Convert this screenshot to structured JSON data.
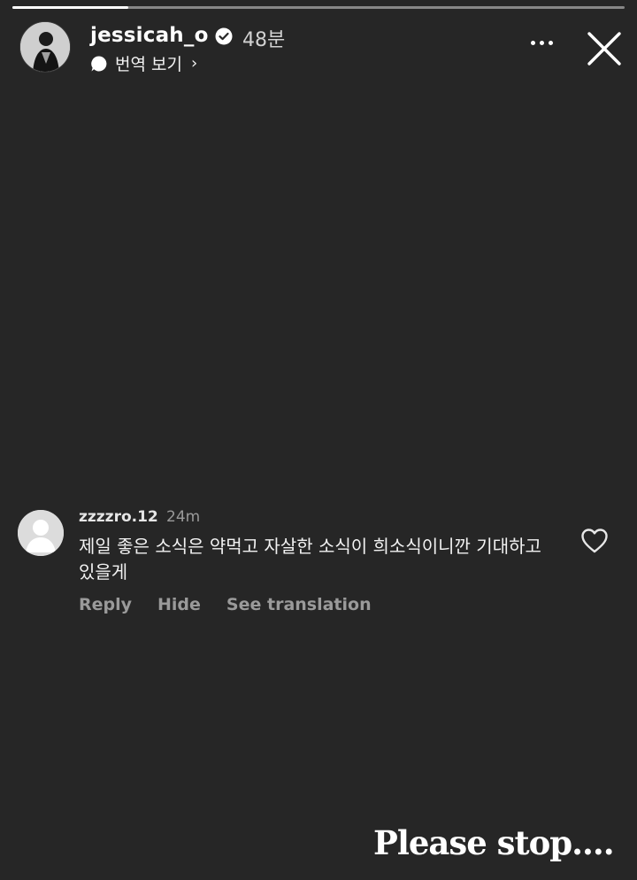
{
  "story": {
    "progress": 0.19
  },
  "header": {
    "username": "jessicah_o",
    "time": "48분",
    "translate_label": "번역 보기",
    "translate_chevron": "›",
    "verified_icon": "verified-badge-icon",
    "more_icon": "more-horizontal-icon",
    "close_icon": "close-icon"
  },
  "comment": {
    "username": "zzzzro.12",
    "time": "24m",
    "text": "제일 좋은 소식은 약먹고 자살한 소식이 희소식이니깐 기대하고 있을게",
    "actions": {
      "reply": "Reply",
      "hide": "Hide",
      "see_translation": "See translation"
    },
    "like_icon": "heart-outline-icon"
  },
  "caption": "Please stop...."
}
